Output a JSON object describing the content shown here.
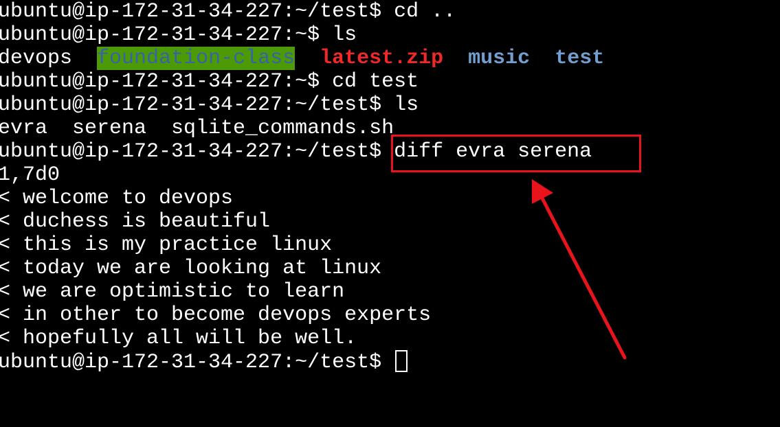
{
  "terminal": {
    "line1": "ubuntu@ip-172-31-34-227:~/test$ cd ..",
    "line2": "ubuntu@ip-172-31-34-227:~$ ls",
    "ls_home": {
      "item1": "devops",
      "item2": "foundation-class",
      "item3": "latest.zip",
      "item4": "music",
      "item5": "test"
    },
    "line4": "ubuntu@ip-172-31-34-227:~$ cd test",
    "line5": "ubuntu@ip-172-31-34-227:~/test$ ls",
    "ls_test": "evra  serena  sqlite_commands.sh",
    "prompt_test": "ubuntu@ip-172-31-34-227:~/test$ ",
    "diff_command": "diff evra serena",
    "diff_header": "1,7d0",
    "diff_lines": [
      "< welcome to devops",
      "< duchess is beautiful",
      "< this is my practice linux",
      "< today we are looking at linux",
      "< we are optimistic to learn",
      "< in other to become devops experts",
      "< hopefully all will be well."
    ],
    "final_prompt": "ubuntu@ip-172-31-34-227:~/test$ "
  },
  "colors": {
    "background": "#000000",
    "text": "#ffffff",
    "directory_highlight_bg": "#4e9a06",
    "directory_highlight_fg": "#3465a4",
    "archive": "#ef2929",
    "directory": "#729fcf",
    "annotation": "#e8131b"
  }
}
